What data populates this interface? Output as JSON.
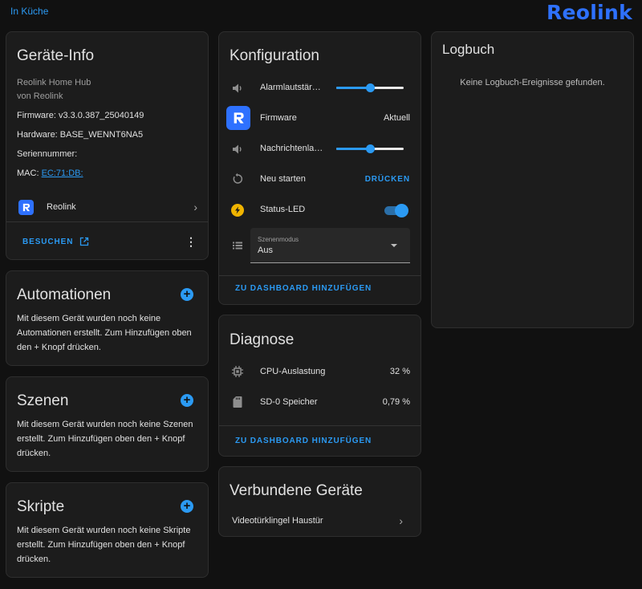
{
  "breadcrumb": "In Küche",
  "brand_logo": "Reolink",
  "device_info": {
    "title": "Geräte-Info",
    "model": "Reolink Home Hub",
    "manufacturer": "von Reolink",
    "firmware": "Firmware: v3.3.0.387_25040149",
    "hardware": "Hardware: BASE_WENNT6NA5",
    "serial": "Seriennummer:",
    "mac_label": "MAC:",
    "mac_value": "EC:71:DB:",
    "integration": "Reolink",
    "visit": "BESUCHEN"
  },
  "automations": {
    "title": "Automationen",
    "text": "Mit diesem Gerät wurden noch keine Automationen erstellt. Zum Hinzufügen oben den + Knopf drücken."
  },
  "scenes": {
    "title": "Szenen",
    "text": "Mit diesem Gerät wurden noch keine Szenen erstellt. Zum Hinzufügen oben den + Knopf drücken."
  },
  "scripts": {
    "title": "Skripte",
    "text": "Mit diesem Gerät wurden noch keine Skripte erstellt. Zum Hinzufügen oben den + Knopf drücken."
  },
  "config": {
    "title": "Konfiguration",
    "alarm_volume": {
      "label": "Alarmlautstär…",
      "value_fraction": 0.5
    },
    "firmware": {
      "label": "Firmware",
      "value": "Aktuell"
    },
    "message_volume": {
      "label": "Nachrichtenla…",
      "value_fraction": 0.5
    },
    "restart": {
      "label": "Neu starten",
      "action": "DRÜCKEN"
    },
    "status_led": {
      "label": "Status-LED",
      "on": true
    },
    "scene_mode": {
      "label": "Szenenmodus",
      "value": "Aus"
    },
    "add_dashboard": "ZU DASHBOARD HINZUFÜGEN"
  },
  "diagnostics": {
    "title": "Diagnose",
    "cpu": {
      "label": "CPU-Auslastung",
      "value": "32 %"
    },
    "sd": {
      "label": "SD-0 Speicher",
      "value": "0,79 %"
    },
    "add_dashboard": "ZU DASHBOARD HINZUFÜGEN"
  },
  "connected": {
    "title": "Verbundene Geräte",
    "item": "Videotürklingel Haustür"
  },
  "logbook": {
    "title": "Logbuch",
    "empty": "Keine Logbuch-Ereignisse gefunden."
  },
  "colors": {
    "accent": "#2b9af3",
    "brand": "#2e71ff",
    "card": "#1c1c1c",
    "background": "#111111"
  }
}
